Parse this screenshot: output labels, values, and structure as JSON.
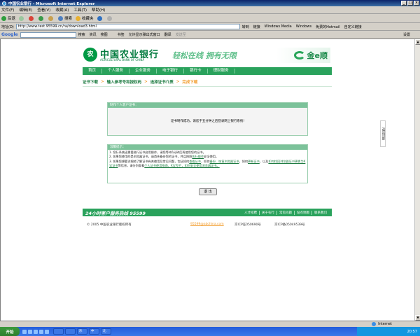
{
  "window": {
    "title": "中国农业银行 - Microsoft Internet Explorer"
  },
  "menubar": [
    "文件(F)",
    "编辑(E)",
    "查看(V)",
    "收藏(A)",
    "工具(T)",
    "帮助(H)"
  ],
  "toolbar": [
    "后退",
    "搜索",
    "收藏夹"
  ],
  "addressbar": {
    "label": "地址(D)",
    "url": "http://www.test.95599.cn/ra/download3.html",
    "go": "转到",
    "links": [
      "链接",
      "Windows Media",
      "Windows",
      "免费的Hotmail",
      "自定义链接"
    ]
  },
  "googlebar": {
    "brand": "Google",
    "items": [
      "搜索",
      "资讯",
      "搜图",
      "书签",
      "允许显示弹出式窗口",
      "翻译",
      "发送至",
      "设置"
    ]
  },
  "page": {
    "bank_name_cn": "中国农业银行",
    "bank_name_en": "AGRICULTURAL BANK OF CHINA",
    "slogan": "轻松在线 拥有无限",
    "brand": "金e顺",
    "nav": [
      "首页",
      "个人服务",
      "企业服务",
      "电子银行",
      "银行卡",
      "理财服务"
    ],
    "breadcrumb": [
      "证书下载",
      "输入参考号和授权码",
      "选择证书介质",
      "完成下载"
    ],
    "panel_title": "制作个人客户证书：",
    "panel_message": "证书制作成功，请您于五分钟之后登录网上银行系统!",
    "tips_title": "温馨提示：",
    "tips": [
      "1. 您行系统还需要进行证书启用操作，请您等待5分钟后再使用您的证书。",
      "2. 如果您使用的是浏览器证书，请首先备份您的证书，并且按照",
      "执行操作",
      "安全使用。",
      "3. 如果您想要详细地了解证书有关使用及常见问题，包括如何",
      "查看证书",
      "，如何",
      "备份、恢复浏览器证书",
      "，如何",
      "更新证书",
      "，以及",
      "如何找回浏览器证书更换为K宝证书",
      "等信息，请分别查看",
      "个人证书使用指南，K宝专栏，如何安全使用浏览器证书。"
    ],
    "exit_button": "退 出",
    "hotline": "24小时客户服务热线 95599",
    "footer_links": [
      "人才招聘",
      "关于农行",
      "常见问题",
      "站点地图",
      "联系我们"
    ],
    "copyright": "© 2005  中国农业银行版权所有",
    "email": "95599@abchina.com",
    "icp1": "京ICP证050690号",
    "icp2": "京ICP备05049539号",
    "side_tab": "返回顶部"
  },
  "statusbar": {
    "zone": "Internet"
  },
  "taskbar": {
    "start": "开始",
    "items": [
      "",
      "",
      "乐",
      "中",
      "北"
    ],
    "time": "20:57"
  }
}
